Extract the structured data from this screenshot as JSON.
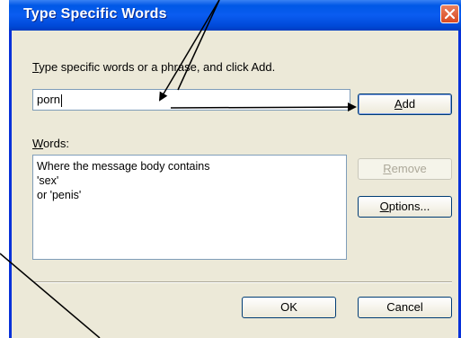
{
  "window": {
    "title": "Type Specific Words"
  },
  "instruction": {
    "underlined_letter": "T",
    "rest": "ype specific words or a phrase, and click Add."
  },
  "word_input": {
    "value": "porn"
  },
  "add_button": {
    "underlined_letter": "A",
    "rest": "dd"
  },
  "words_label": {
    "underlined_letter": "W",
    "rest": "ords:"
  },
  "words_list": {
    "lines": [
      "Where the message body contains",
      "'sex'",
      "or 'penis'"
    ]
  },
  "remove_button": {
    "underlined_letter": "R",
    "rest": "emove",
    "state": "disabled"
  },
  "options_button": {
    "underlined_letter": "O",
    "rest": "ptions..."
  },
  "ok_button": {
    "label": "OK"
  },
  "cancel_button": {
    "label": "Cancel"
  },
  "colors": {
    "title_bar": "#0058e6",
    "dialog_background": "#ece9d8",
    "close_button": "#d94a22"
  }
}
